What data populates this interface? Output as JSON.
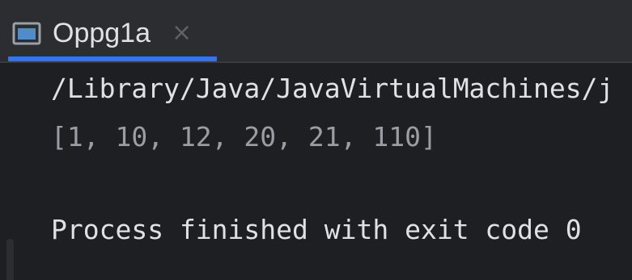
{
  "run_tab": {
    "title": "Oppg1a",
    "close_symbol": "×",
    "icon": "console-icon",
    "accent_color": "#3574f0"
  },
  "console": {
    "lines": [
      "/Library/Java/JavaVirtualMachines/j",
      "[1, 10, 12, 20, 21, 110]",
      "Process finished with exit code 0"
    ]
  }
}
